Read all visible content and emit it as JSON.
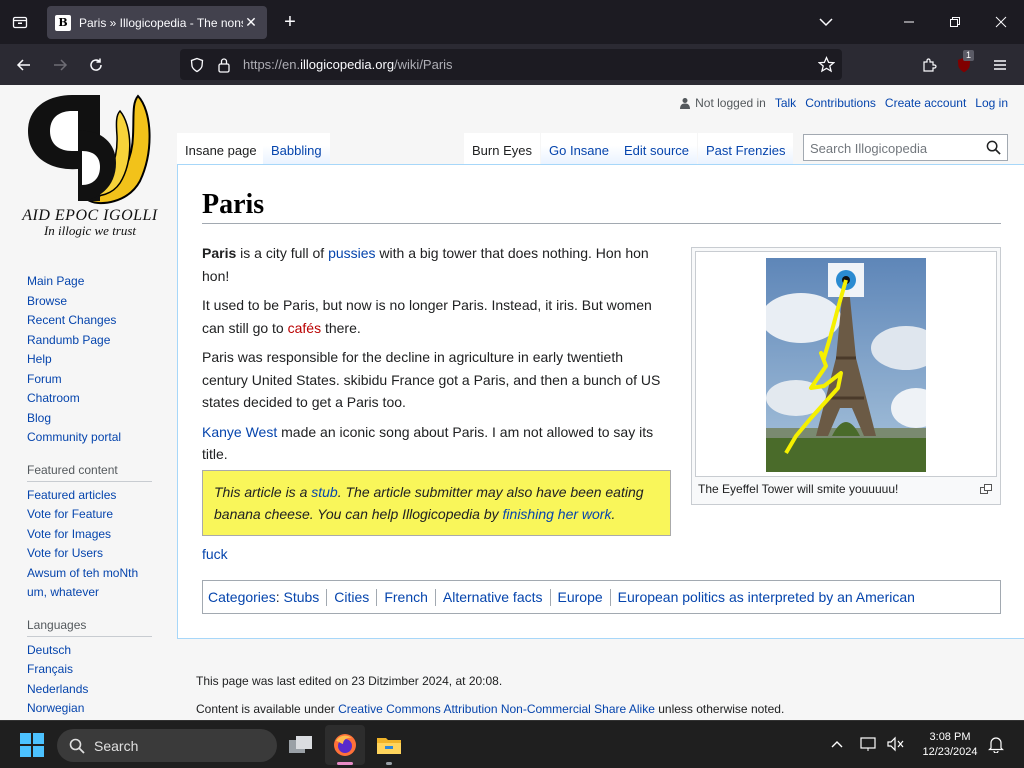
{
  "browser": {
    "tab_title": "Paris » Illogicopedia - The nonsensical encyclopedia",
    "url_prefix": "https://en.",
    "url_domain": "illogicopedia.org",
    "url_path": "/wiki/Paris",
    "extension_badge": "1"
  },
  "logo": {
    "line1": "AID EPOC IGOLLI",
    "line2": "In illogic we trust"
  },
  "sidebar": {
    "nav": [
      "Main Page",
      "Browse",
      "Recent Changes",
      "Randumb Page",
      "Help",
      "Forum",
      "Chatroom",
      "Blog",
      "Community portal"
    ],
    "featured_heading": "Featured content",
    "featured": [
      "Featured articles",
      "Vote for Feature",
      "Vote for Images",
      "Vote for Users",
      "Awsum of teh moNth",
      "um, whatever"
    ],
    "languages_heading": "Languages",
    "languages": [
      "Deutsch",
      "Français",
      "Nederlands",
      "Norwegian"
    ]
  },
  "personal": {
    "not_logged_in": "Not logged in",
    "talk": "Talk",
    "contributions": "Contributions",
    "create_account": "Create account",
    "log_in": "Log in"
  },
  "tabs": {
    "insane_page": "Insane page",
    "babbling": "Babbling",
    "burn_eyes": "Burn Eyes",
    "go_insane": "Go Insane",
    "edit_source": "Edit source",
    "past_frenzies": "Past Frenzies"
  },
  "search": {
    "placeholder": "Search Illogicopedia"
  },
  "article": {
    "title": "Paris",
    "p1_bold": "Paris",
    "p1_a": " is a city full of ",
    "p1_link": "pussies",
    "p1_b": " with a big tower that does nothing. Hon hon hon!",
    "p2_a": "It used to be Paris, but now is no longer Paris. Instead, it iris. But women can still go to ",
    "p2_link": "cafés",
    "p2_b": " there.",
    "p3": "Paris was responsible for the decline in agriculture in early twentieth century United States. skibidu France got a Paris, and then a bunch of US states decided to get a Paris too.",
    "p4_link": "Kanye West",
    "p4_b": " made an iconic song about Paris. I am not allowed to say its title.",
    "stub_a": "This article is a ",
    "stub_link1": "stub",
    "stub_b": ". The article submitter may also have been eating banana cheese. You can help Illogicopedia by ",
    "stub_link2": "finishing her work",
    "stub_c": ".",
    "extra_link": "fuck",
    "image_caption": "The Eyeffel Tower will smite youuuuu!"
  },
  "categories": {
    "label": "Categories",
    "items": [
      "Stubs",
      "Cities",
      "French",
      "Alternative facts",
      "Europe",
      "European politics as interpreted by an American"
    ]
  },
  "footer": {
    "last_edited": "This page was last edited on 23 Ditzimber 2024, at 20:08.",
    "license_a": "Content is available under ",
    "license_link": "Creative Commons Attribution Non-Commercial Share Alike",
    "license_b": " unless otherwise noted."
  },
  "taskbar": {
    "search_label": "Search",
    "time": "3:08 PM",
    "date": "12/23/2024"
  }
}
